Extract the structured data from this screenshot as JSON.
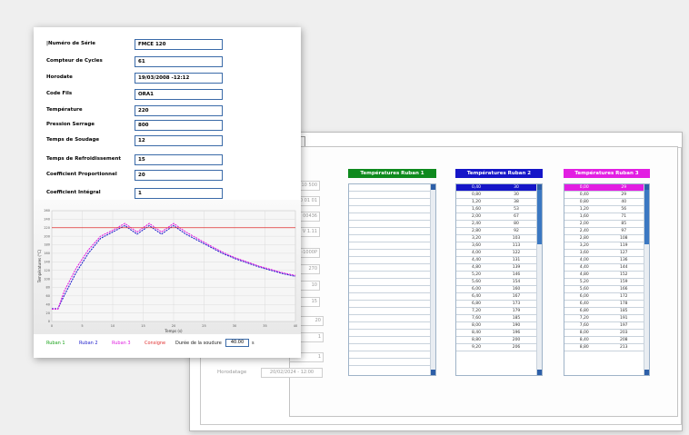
{
  "form": {
    "fields": [
      {
        "label": "|Numéro de Série",
        "value": "FMCE 120"
      },
      {
        "label": "Compteur de Cycles",
        "value": "61"
      },
      {
        "label": "Horodate",
        "value": "19/03/2008 -12:12"
      },
      {
        "label": "Code Fils",
        "value": "ORA1"
      },
      {
        "label": "Température",
        "value": "220"
      },
      {
        "label": "Pression Serrage",
        "value": "800"
      },
      {
        "label": "Temps de Soudage",
        "value": "12"
      },
      {
        "label": "Temps de Refroidissement",
        "value": "15"
      },
      {
        "label": "Coefficient Proportionnel",
        "value": "20"
      },
      {
        "label": "Coefficient Intégral",
        "value": "1"
      }
    ],
    "legend": {
      "ruban1": "Ruban 1",
      "ruban2": "Ruban 2",
      "ruban3": "Ruban 3",
      "consigne": "Consigne",
      "duree_label": "Durée de la soudure",
      "duree_value": "40.00",
      "duree_unit": "s"
    },
    "colors": {
      "ruban1": "#1aa31a",
      "ruban2": "#2222cc",
      "ruban3": "#e01ee0",
      "consigne": "#e03030"
    }
  },
  "back": {
    "ghost_values": [
      "N 10 500",
      "100 01 01",
      "2 00436",
      "V 1.11",
      "I-1000P",
      "270",
      "10",
      "15",
      "20",
      "1",
      "1"
    ],
    "horodatage_label": "Horodatage",
    "horodatage_value": "20/02/2024 - 12:00"
  },
  "rubans": [
    {
      "title": "Températures Ruban 1",
      "color": "#0e8a1e",
      "rows": []
    },
    {
      "title": "Températures Ruban 2",
      "color": "#1515c8",
      "rows": [
        [
          "0,40",
          "30"
        ],
        [
          "0,80",
          "30"
        ],
        [
          "1,20",
          "38"
        ],
        [
          "1,60",
          "53"
        ],
        [
          "2,00",
          "67"
        ],
        [
          "2,40",
          "80"
        ],
        [
          "2,80",
          "92"
        ],
        [
          "3,20",
          "103"
        ],
        [
          "3,60",
          "113"
        ],
        [
          "4,00",
          "122"
        ],
        [
          "4,40",
          "131"
        ],
        [
          "4,80",
          "139"
        ],
        [
          "5,20",
          "146"
        ],
        [
          "5,60",
          "154"
        ],
        [
          "6,00",
          "160"
        ],
        [
          "6,40",
          "167"
        ],
        [
          "6,80",
          "173"
        ],
        [
          "7,20",
          "179"
        ],
        [
          "7,60",
          "185"
        ],
        [
          "8,00",
          "190"
        ],
        [
          "8,40",
          "196"
        ],
        [
          "8,80",
          "200"
        ],
        [
          "9,20",
          "206"
        ]
      ]
    },
    {
      "title": "Températures Ruban 3",
      "color": "#e21ee2",
      "rows": [
        [
          "0,00",
          "29"
        ],
        [
          "0,40",
          "29"
        ],
        [
          "0,80",
          "40"
        ],
        [
          "1,20",
          "56"
        ],
        [
          "1,60",
          "71"
        ],
        [
          "2,00",
          "85"
        ],
        [
          "2,40",
          "97"
        ],
        [
          "2,80",
          "108"
        ],
        [
          "3,20",
          "119"
        ],
        [
          "3,60",
          "127"
        ],
        [
          "4,00",
          "136"
        ],
        [
          "4,40",
          "144"
        ],
        [
          "4,80",
          "152"
        ],
        [
          "5,20",
          "159"
        ],
        [
          "5,60",
          "166"
        ],
        [
          "6,00",
          "172"
        ],
        [
          "6,40",
          "178"
        ],
        [
          "6,80",
          "185"
        ],
        [
          "7,20",
          "191"
        ],
        [
          "7,60",
          "197"
        ],
        [
          "8,00",
          "203"
        ],
        [
          "8,40",
          "208"
        ],
        [
          "8,80",
          "213"
        ]
      ]
    }
  ],
  "chart_data": {
    "type": "line",
    "xlabel": "Temps (s)",
    "ylabel": "Températures (°C)",
    "xlim": [
      0,
      40
    ],
    "ylim": [
      0,
      260
    ],
    "grid": true,
    "series": [
      {
        "name": "Ruban 2",
        "color": "#2222cc",
        "dashed": true,
        "x": [
          0,
          1,
          2,
          4,
          6,
          8,
          10,
          12,
          14,
          16,
          18,
          20,
          22,
          24,
          26,
          28,
          30,
          32,
          34,
          36,
          38,
          40
        ],
        "y": [
          30,
          30,
          60,
          115,
          160,
          195,
          210,
          225,
          205,
          225,
          205,
          225,
          205,
          190,
          175,
          160,
          148,
          138,
          128,
          120,
          112,
          106
        ]
      },
      {
        "name": "Ruban 3",
        "color": "#e01ee0",
        "dashed": true,
        "x": [
          0,
          1,
          2,
          4,
          6,
          8,
          10,
          12,
          14,
          16,
          18,
          20,
          22,
          24,
          26,
          28,
          30,
          32,
          34,
          36,
          38,
          40
        ],
        "y": [
          29,
          29,
          70,
          125,
          168,
          200,
          214,
          230,
          210,
          230,
          210,
          230,
          210,
          194,
          178,
          163,
          150,
          140,
          130,
          122,
          114,
          108
        ]
      },
      {
        "name": "Consigne",
        "color": "#e03030",
        "dashed": false,
        "x": [
          0,
          40
        ],
        "y": [
          220,
          220
        ]
      }
    ]
  }
}
